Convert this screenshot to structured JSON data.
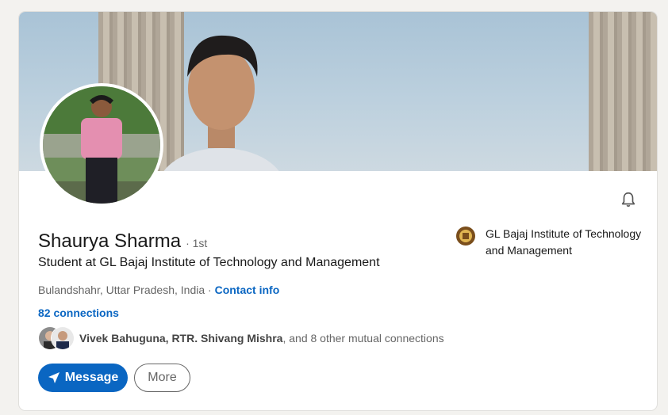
{
  "profile": {
    "name": "Shaurya Sharma",
    "degree": "· 1st",
    "headline": "Student at GL Bajaj Institute of Technology and Management",
    "location": "Bulandshahr, Uttar Pradesh, India",
    "location_separator": " · ",
    "contact_info": "Contact info",
    "connections": "82 connections",
    "mutual": {
      "names": "Vivek Bahuguna, RTR. Shivang Mishra",
      "suffix": ", and 8 other mutual connections"
    },
    "education": "GL Bajaj Institute of Technology and Management"
  },
  "actions": {
    "message_label": "Message",
    "more_label": "More"
  },
  "icons": {
    "bell": "bell-icon",
    "message": "send-icon"
  },
  "colors": {
    "brand_blue": "#0a66c2",
    "background": "#f3f2ef"
  }
}
